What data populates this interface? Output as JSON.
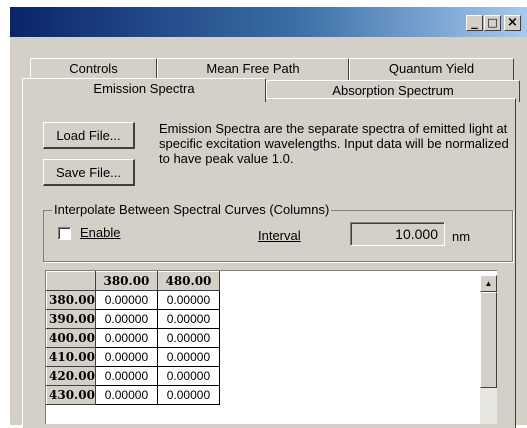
{
  "window": {
    "controls": {
      "minimize": "_",
      "maximize": "□",
      "close": "×"
    }
  },
  "tabs": {
    "row1": [
      "Controls",
      "Mean Free Path",
      "Quantum Yield"
    ],
    "row2": [
      "Emission Spectra",
      "Absorption Spectrum"
    ],
    "active": "Emission Spectra"
  },
  "buttons": {
    "load": "Load File...",
    "save": "Save File..."
  },
  "description": "Emission Spectra are the separate spectra of emitted light at specific excitation wavelengths. Input data will be normalized to have peak value 1.0.",
  "interpolate": {
    "group_label": "Interpolate Between Spectral Curves (Columns)",
    "enable_label": "Enable",
    "enable_checked": false,
    "interval_label": "Interval",
    "interval_value": "10.000",
    "unit": "nm"
  },
  "grid": {
    "columns": [
      "380.00",
      "480.00"
    ],
    "rows": [
      {
        "label": "380.00",
        "values": [
          "0.00000",
          "0.00000"
        ]
      },
      {
        "label": "390.00",
        "values": [
          "0.00000",
          "0.00000"
        ]
      },
      {
        "label": "400.00",
        "values": [
          "0.00000",
          "0.00000"
        ]
      },
      {
        "label": "410.00",
        "values": [
          "0.00000",
          "0.00000"
        ]
      },
      {
        "label": "420.00",
        "values": [
          "0.00000",
          "0.00000"
        ]
      },
      {
        "label": "430.00",
        "values": [
          "0.00000",
          "0.00000"
        ]
      }
    ]
  },
  "scrollbar": {
    "up_arrow": "▲"
  }
}
